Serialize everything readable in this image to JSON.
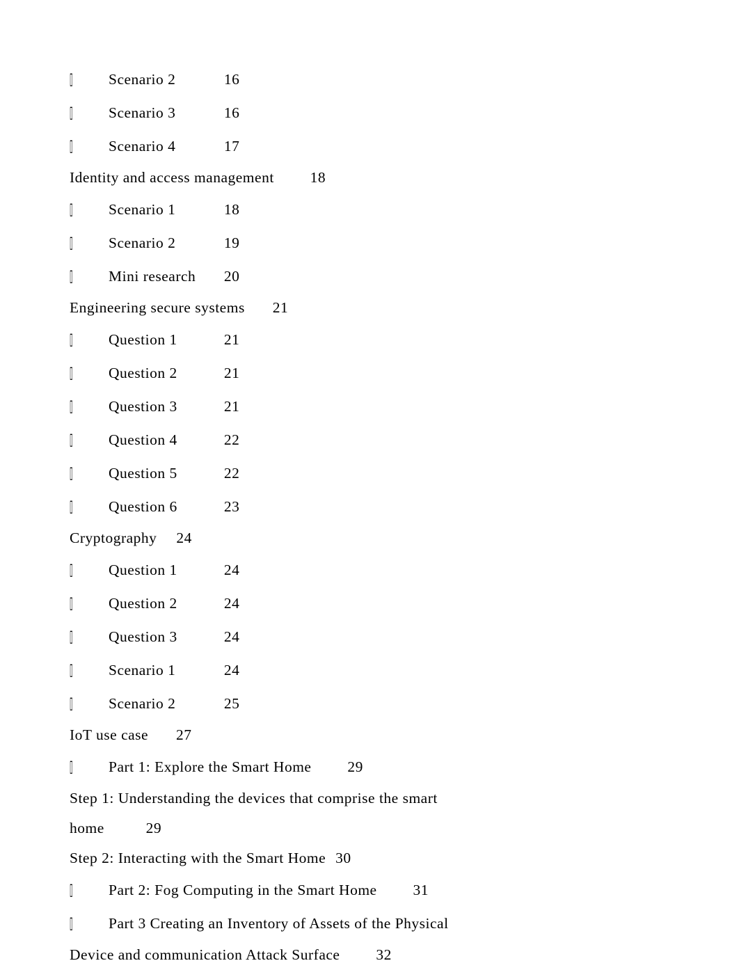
{
  "toc": {
    "entries": [
      {
        "level": "sub",
        "label": "Scenario 2",
        "page": "16"
      },
      {
        "level": "sub",
        "label": "Scenario 3",
        "page": "16"
      },
      {
        "level": "sub",
        "label": "Scenario 4",
        "page": "17"
      },
      {
        "level": "section",
        "label": "Identity and access management",
        "page": "18"
      },
      {
        "level": "sub",
        "label": "Scenario 1",
        "page": "18"
      },
      {
        "level": "sub",
        "label": "Scenario 2",
        "page": "19"
      },
      {
        "level": "sub",
        "label": "Mini research",
        "page": "20"
      },
      {
        "level": "section",
        "label": "Engineering secure systems",
        "page": "21"
      },
      {
        "level": "sub",
        "label": "Question 1",
        "page": "21"
      },
      {
        "level": "sub",
        "label": "Question 2",
        "page": "21"
      },
      {
        "level": "sub",
        "label": "Question 3",
        "page": "21"
      },
      {
        "level": "sub",
        "label": "Question 4",
        "page": "22"
      },
      {
        "level": "sub",
        "label": "Question 5",
        "page": "22"
      },
      {
        "level": "sub",
        "label": "Question 6",
        "page": "23"
      },
      {
        "level": "section",
        "label": "Cryptography",
        "page": "24"
      },
      {
        "level": "sub",
        "label": "Question 1",
        "page": "24"
      },
      {
        "level": "sub",
        "label": "Question 2",
        "page": "24"
      },
      {
        "level": "sub",
        "label": "Question 3",
        "page": "24"
      },
      {
        "level": "sub",
        "label": "Scenario 1",
        "page": "24"
      },
      {
        "level": "sub",
        "label": "Scenario 2",
        "page": "25"
      },
      {
        "level": "section",
        "label": "IoT use case",
        "page": "27"
      },
      {
        "level": "sub",
        "label": "Part 1: Explore the Smart Home",
        "page": "29"
      },
      {
        "level": "step",
        "label_a": "Step 1: Understanding the devices that comprise the smart",
        "label_b": "home",
        "page": "29"
      },
      {
        "level": "step_single",
        "label": "Step 2: Interacting with the Smart Home",
        "page": "30"
      },
      {
        "level": "sub",
        "label": "Part 2: Fog Computing in the Smart Home",
        "page": "31"
      },
      {
        "level": "sub_wrap",
        "label_a": "Part 3 Creating an Inventory of Assets of the Physical",
        "label_b": "Device and communication Attack Surface",
        "page": "32"
      }
    ]
  }
}
